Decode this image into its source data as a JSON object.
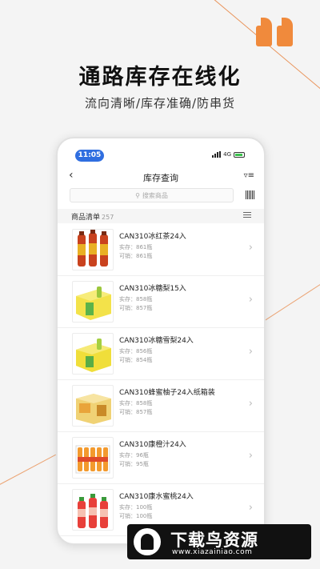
{
  "colors": {
    "accent": "#f08a3c",
    "status_time_bg": "#2f6ee0"
  },
  "hero": {
    "title": "通路库存在线化",
    "subtitle": "流向清晰/库存准确/防串货"
  },
  "status_bar": {
    "time": "11:05",
    "network": "4G"
  },
  "nav": {
    "back_icon": "chevron-left-icon",
    "title": "库存查询",
    "filter_icon": "filter-icon"
  },
  "search": {
    "placeholder": "搜索商品",
    "icon": "search-icon",
    "scan_icon": "barcode-icon"
  },
  "list": {
    "label": "商品清单",
    "count": "257",
    "items": [
      {
        "name": "CAN310冰红茶24入",
        "stock": "实存：861瓶",
        "sellable": "可销：861瓶",
        "image": "three-bottles-red-tea"
      },
      {
        "name": "CAN310冰糖梨15入",
        "stock": "实存：858瓶",
        "sellable": "可销：857瓶",
        "image": "yellow-case-pear"
      },
      {
        "name": "CAN310冰糖雪梨24入",
        "stock": "实存：856瓶",
        "sellable": "可销：854瓶",
        "image": "yellow-case-pear"
      },
      {
        "name": "CAN310蜂蜜柚子24入纸箱装",
        "stock": "实存：858瓶",
        "sellable": "可销：857瓶",
        "image": "cardboard-case-honey"
      },
      {
        "name": "CAN310康橙汁24入",
        "stock": "实存：96瓶",
        "sellable": "可销：95瓶",
        "image": "orange-juice-pack"
      },
      {
        "name": "CAN310康水蜜桃24入",
        "stock": "实存：100瓶",
        "sellable": "可销：100瓶",
        "image": "peach-bottles"
      }
    ]
  },
  "watermark": {
    "title": "下载鸟资源",
    "url": "www.xiazainiao.com"
  }
}
